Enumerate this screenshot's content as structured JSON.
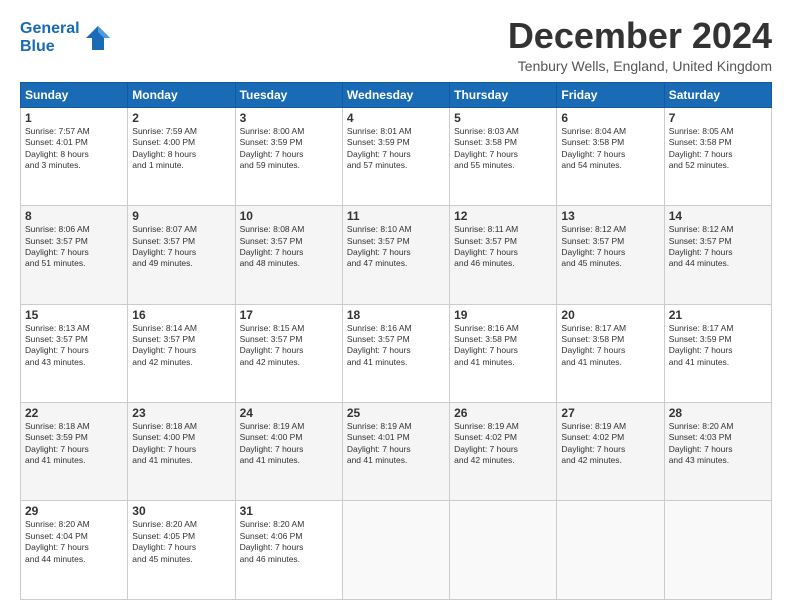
{
  "header": {
    "logo_line1": "General",
    "logo_line2": "Blue",
    "month": "December 2024",
    "location": "Tenbury Wells, England, United Kingdom"
  },
  "weekdays": [
    "Sunday",
    "Monday",
    "Tuesday",
    "Wednesday",
    "Thursday",
    "Friday",
    "Saturday"
  ],
  "weeks": [
    [
      {
        "day": "1",
        "info": "Sunrise: 7:57 AM\nSunset: 4:01 PM\nDaylight: 8 hours\nand 3 minutes."
      },
      {
        "day": "2",
        "info": "Sunrise: 7:59 AM\nSunset: 4:00 PM\nDaylight: 8 hours\nand 1 minute."
      },
      {
        "day": "3",
        "info": "Sunrise: 8:00 AM\nSunset: 3:59 PM\nDaylight: 7 hours\nand 59 minutes."
      },
      {
        "day": "4",
        "info": "Sunrise: 8:01 AM\nSunset: 3:59 PM\nDaylight: 7 hours\nand 57 minutes."
      },
      {
        "day": "5",
        "info": "Sunrise: 8:03 AM\nSunset: 3:58 PM\nDaylight: 7 hours\nand 55 minutes."
      },
      {
        "day": "6",
        "info": "Sunrise: 8:04 AM\nSunset: 3:58 PM\nDaylight: 7 hours\nand 54 minutes."
      },
      {
        "day": "7",
        "info": "Sunrise: 8:05 AM\nSunset: 3:58 PM\nDaylight: 7 hours\nand 52 minutes."
      }
    ],
    [
      {
        "day": "8",
        "info": "Sunrise: 8:06 AM\nSunset: 3:57 PM\nDaylight: 7 hours\nand 51 minutes."
      },
      {
        "day": "9",
        "info": "Sunrise: 8:07 AM\nSunset: 3:57 PM\nDaylight: 7 hours\nand 49 minutes."
      },
      {
        "day": "10",
        "info": "Sunrise: 8:08 AM\nSunset: 3:57 PM\nDaylight: 7 hours\nand 48 minutes."
      },
      {
        "day": "11",
        "info": "Sunrise: 8:10 AM\nSunset: 3:57 PM\nDaylight: 7 hours\nand 47 minutes."
      },
      {
        "day": "12",
        "info": "Sunrise: 8:11 AM\nSunset: 3:57 PM\nDaylight: 7 hours\nand 46 minutes."
      },
      {
        "day": "13",
        "info": "Sunrise: 8:12 AM\nSunset: 3:57 PM\nDaylight: 7 hours\nand 45 minutes."
      },
      {
        "day": "14",
        "info": "Sunrise: 8:12 AM\nSunset: 3:57 PM\nDaylight: 7 hours\nand 44 minutes."
      }
    ],
    [
      {
        "day": "15",
        "info": "Sunrise: 8:13 AM\nSunset: 3:57 PM\nDaylight: 7 hours\nand 43 minutes."
      },
      {
        "day": "16",
        "info": "Sunrise: 8:14 AM\nSunset: 3:57 PM\nDaylight: 7 hours\nand 42 minutes."
      },
      {
        "day": "17",
        "info": "Sunrise: 8:15 AM\nSunset: 3:57 PM\nDaylight: 7 hours\nand 42 minutes."
      },
      {
        "day": "18",
        "info": "Sunrise: 8:16 AM\nSunset: 3:57 PM\nDaylight: 7 hours\nand 41 minutes."
      },
      {
        "day": "19",
        "info": "Sunrise: 8:16 AM\nSunset: 3:58 PM\nDaylight: 7 hours\nand 41 minutes."
      },
      {
        "day": "20",
        "info": "Sunrise: 8:17 AM\nSunset: 3:58 PM\nDaylight: 7 hours\nand 41 minutes."
      },
      {
        "day": "21",
        "info": "Sunrise: 8:17 AM\nSunset: 3:59 PM\nDaylight: 7 hours\nand 41 minutes."
      }
    ],
    [
      {
        "day": "22",
        "info": "Sunrise: 8:18 AM\nSunset: 3:59 PM\nDaylight: 7 hours\nand 41 minutes."
      },
      {
        "day": "23",
        "info": "Sunrise: 8:18 AM\nSunset: 4:00 PM\nDaylight: 7 hours\nand 41 minutes."
      },
      {
        "day": "24",
        "info": "Sunrise: 8:19 AM\nSunset: 4:00 PM\nDaylight: 7 hours\nand 41 minutes."
      },
      {
        "day": "25",
        "info": "Sunrise: 8:19 AM\nSunset: 4:01 PM\nDaylight: 7 hours\nand 41 minutes."
      },
      {
        "day": "26",
        "info": "Sunrise: 8:19 AM\nSunset: 4:02 PM\nDaylight: 7 hours\nand 42 minutes."
      },
      {
        "day": "27",
        "info": "Sunrise: 8:19 AM\nSunset: 4:02 PM\nDaylight: 7 hours\nand 42 minutes."
      },
      {
        "day": "28",
        "info": "Sunrise: 8:20 AM\nSunset: 4:03 PM\nDaylight: 7 hours\nand 43 minutes."
      }
    ],
    [
      {
        "day": "29",
        "info": "Sunrise: 8:20 AM\nSunset: 4:04 PM\nDaylight: 7 hours\nand 44 minutes."
      },
      {
        "day": "30",
        "info": "Sunrise: 8:20 AM\nSunset: 4:05 PM\nDaylight: 7 hours\nand 45 minutes."
      },
      {
        "day": "31",
        "info": "Sunrise: 8:20 AM\nSunset: 4:06 PM\nDaylight: 7 hours\nand 46 minutes."
      },
      {
        "day": "",
        "info": ""
      },
      {
        "day": "",
        "info": ""
      },
      {
        "day": "",
        "info": ""
      },
      {
        "day": "",
        "info": ""
      }
    ]
  ]
}
